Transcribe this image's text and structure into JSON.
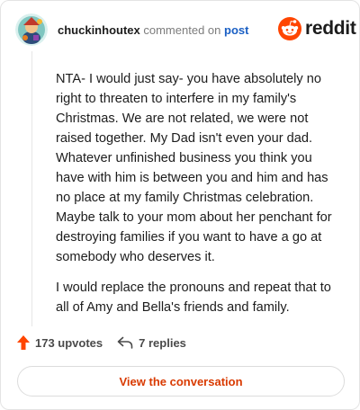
{
  "header": {
    "username": "chuckinhoutex",
    "commented_text": "commented on",
    "post_link": "post",
    "logo_text": "reddit"
  },
  "comment": {
    "paragraphs": [
      "NTA- I would just say- you have absolutely no right to threaten to interfere in my family's Christmas. We are not related, we were not raised together. My Dad isn't even your dad. Whatever unfinished business you think you have with him is between you and him and has no place at my family Christmas celebration. Maybe talk to your mom about her penchant for destroying families if you want to have a go at somebody who deserves it.",
      "I would replace the pronouns and repeat that to all of Amy and Bella's friends and family."
    ]
  },
  "actions": {
    "upvotes": "173 upvotes",
    "replies": "7 replies"
  },
  "footer": {
    "view_button": "View the conversation"
  },
  "colors": {
    "brand": "#ff4500",
    "link": "#1a5fc4",
    "button_text": "#d93a00"
  },
  "icons": {
    "avatar": "user-avatar",
    "logo": "reddit-snoo-icon",
    "upvote": "upvote-arrow-icon",
    "reply": "reply-arrow-icon"
  }
}
